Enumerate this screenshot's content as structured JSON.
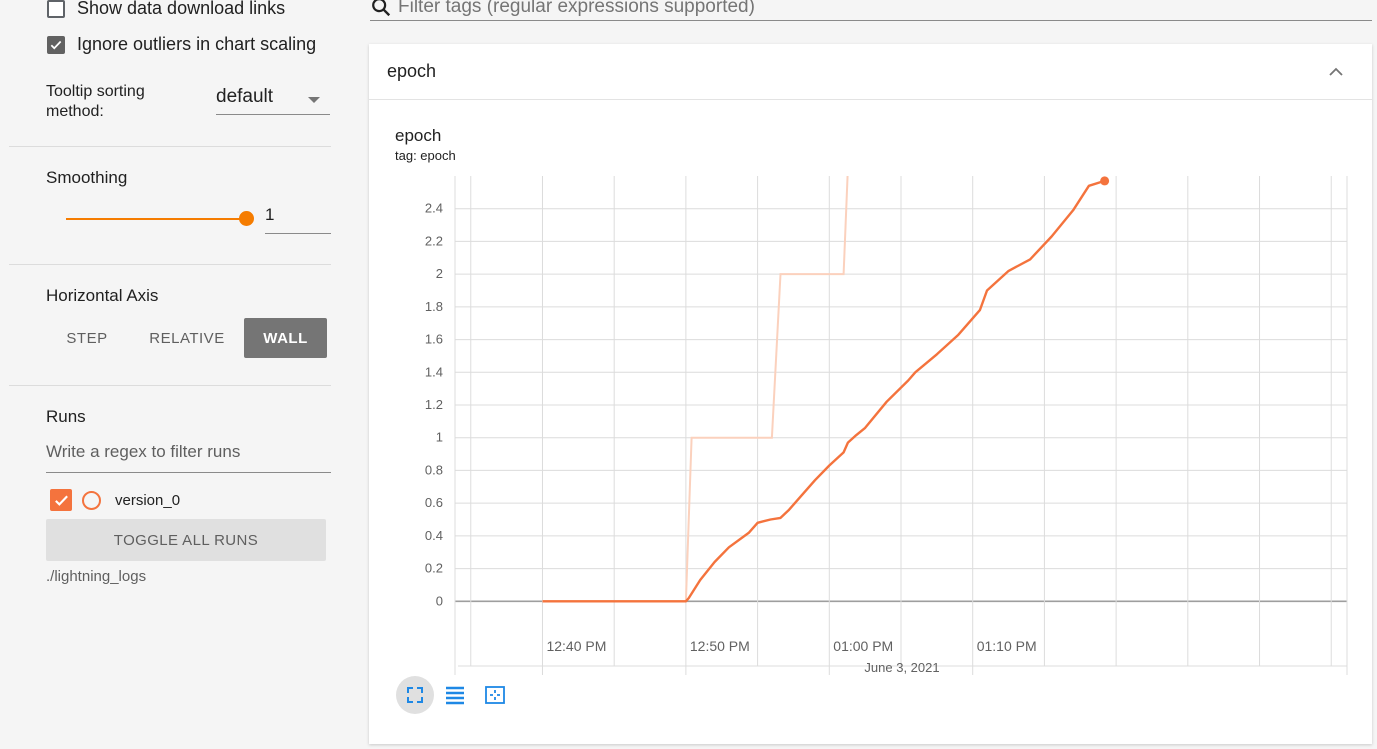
{
  "sidebar": {
    "show_download_links": "Show data download links",
    "ignore_outliers": "Ignore outliers in chart scaling",
    "tooltip_sorting_label_1": "Tooltip sorting",
    "tooltip_sorting_label_2": "method:",
    "tooltip_sorting_value": "default",
    "smoothing_title": "Smoothing",
    "smoothing_value": "1",
    "smoothing_level": 1.0,
    "horizontal_axis_title": "Horizontal Axis",
    "axis_options": [
      "STEP",
      "RELATIVE",
      "WALL"
    ],
    "axis_selected": "WALL",
    "runs_title": "Runs",
    "runs_filter_placeholder": "Write a regex to filter runs",
    "run_name": "version_0",
    "toggle_all_runs": "TOGGLE ALL RUNS",
    "logdir": "./lightning_logs"
  },
  "main": {
    "filter_placeholder": "Filter tags (regular expressions supported)",
    "card_title": "epoch",
    "chart_title": "epoch",
    "chart_tag": "tag: epoch"
  },
  "colors": {
    "accent": "#f57c00",
    "run": "#f4733d",
    "run_raw": "#fbd1bd"
  },
  "icons": [
    "search-icon",
    "chevron-up-icon",
    "check-icon",
    "fit-to-data-icon",
    "log-scale-icon",
    "reset-zoom-icon"
  ],
  "chart_data": {
    "type": "line",
    "title": "epoch",
    "subtitle": "tag: epoch",
    "xlabel": "June 3, 2021",
    "x_tick_labels": [
      "12:40 PM",
      "12:50 PM",
      "01:00 PM",
      "01:10 PM"
    ],
    "x_ticks_min": [
      -15,
      -10,
      -5,
      0,
      5,
      10,
      15,
      20,
      25,
      30,
      35,
      40,
      45
    ],
    "x_range_min": [
      -16.1,
      46.1
    ],
    "ylim": [
      -0.2,
      2.6
    ],
    "y_ticks": [
      0,
      0.2,
      0.4,
      0.6,
      0.8,
      1,
      1.2,
      1.4,
      1.6,
      1.8,
      2,
      2.2,
      2.4
    ],
    "y_tick_labels": [
      "0",
      "0.2",
      "0.4",
      "0.6",
      "0.8",
      "1",
      "1.2",
      "1.4",
      "1.6",
      "1.8",
      "2",
      "2.2",
      "2.4"
    ],
    "x_axis_note": "x values are minutes after 12:40 PM",
    "series": [
      {
        "name": "version_0",
        "smoothed": true,
        "x": [
          -10,
          -5,
          0,
          0.2,
          1,
          2,
          3,
          4.4,
          5,
          5.9,
          6.6,
          7.2,
          8,
          9,
          10,
          11,
          11.3,
          11.8,
          12.5,
          14,
          15.5,
          16,
          17.5,
          19,
          20.5,
          21,
          22.5,
          24,
          25.5,
          27,
          28.1,
          29.2
        ],
        "y": [
          0,
          0,
          0,
          0.02,
          0.13,
          0.24,
          0.33,
          0.42,
          0.48,
          0.5,
          0.51,
          0.56,
          0.64,
          0.74,
          0.83,
          0.91,
          0.97,
          1.01,
          1.06,
          1.22,
          1.35,
          1.4,
          1.51,
          1.63,
          1.78,
          1.9,
          2.02,
          2.09,
          2.23,
          2.39,
          2.54,
          2.57
        ]
      },
      {
        "name": "version_0",
        "smoothed": false,
        "x": [
          -10,
          0,
          0.4,
          6.0,
          6.6,
          10.5,
          11,
          11.3
        ],
        "y": [
          0,
          0,
          1,
          1,
          2,
          2,
          2,
          2.65
        ]
      }
    ]
  }
}
